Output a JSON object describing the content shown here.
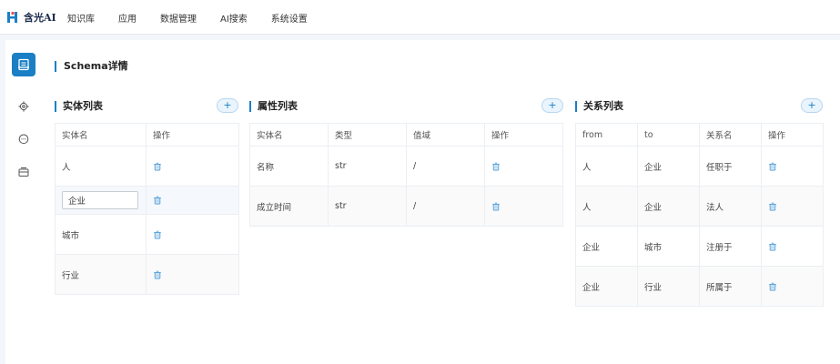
{
  "brand": {
    "name": "含光AI"
  },
  "nav": {
    "items": [
      "知识库",
      "应用",
      "数据管理",
      "AI搜索",
      "系统设置"
    ]
  },
  "sidebar": {
    "icons": [
      "document-icon",
      "gear-icon",
      "chat-icon",
      "folder-icon"
    ]
  },
  "page": {
    "title": "Schema详情"
  },
  "entities": {
    "title": "实体列表",
    "add_label": "+",
    "columns": [
      "实体名",
      "操作"
    ],
    "rows": [
      {
        "name": "人"
      },
      {
        "name": "企业",
        "editing": true
      },
      {
        "name": "城市"
      },
      {
        "name": "行业"
      }
    ]
  },
  "attributes": {
    "title": "属性列表",
    "add_label": "+",
    "columns": [
      "实体名",
      "类型",
      "值域",
      "操作"
    ],
    "rows": [
      {
        "name": "名称",
        "type": "str",
        "range": "/"
      },
      {
        "name": "成立时间",
        "type": "str",
        "range": "/"
      }
    ]
  },
  "relations": {
    "title": "关系列表",
    "add_label": "+",
    "columns": [
      "from",
      "to",
      "关系名",
      "操作"
    ],
    "rows": [
      {
        "from": "人",
        "to": "企业",
        "name": "任职于"
      },
      {
        "from": "人",
        "to": "企业",
        "name": "法人"
      },
      {
        "from": "企业",
        "to": "城市",
        "name": "注册于"
      },
      {
        "from": "企业",
        "to": "行业",
        "name": "所属于"
      }
    ]
  },
  "colors": {
    "accent": "#1a7fc4",
    "border": "#ebeef3",
    "background": "#f3f6fa"
  }
}
